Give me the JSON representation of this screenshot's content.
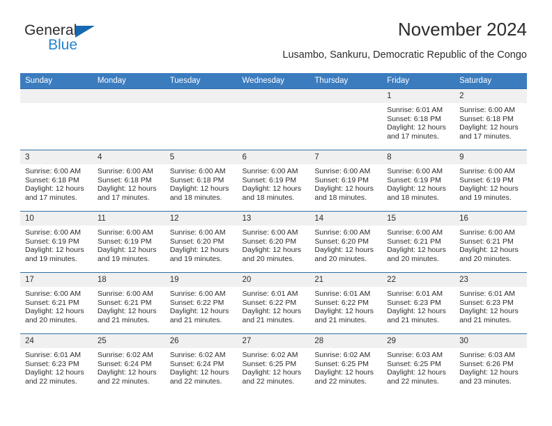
{
  "brand": {
    "name_part1": "General",
    "name_part2": "Blue",
    "triangle_color": "#1769b0",
    "blue_color": "#2484cd"
  },
  "header": {
    "title": "November 2024",
    "subtitle": "Lusambo, Sankuru, Democratic Republic of the Congo"
  },
  "theme": {
    "header_bar": "#3b7cbf",
    "cell_top_border": "#2e6da4",
    "daynum_bg": "#f0f0f0",
    "text": "#2b2b2b"
  },
  "calendar": {
    "weekdays": [
      "Sunday",
      "Monday",
      "Tuesday",
      "Wednesday",
      "Thursday",
      "Friday",
      "Saturday"
    ],
    "weeks": [
      [
        {
          "day": "",
          "lines": []
        },
        {
          "day": "",
          "lines": []
        },
        {
          "day": "",
          "lines": []
        },
        {
          "day": "",
          "lines": []
        },
        {
          "day": "",
          "lines": []
        },
        {
          "day": "1",
          "lines": [
            "Sunrise: 6:01 AM",
            "Sunset: 6:18 PM",
            "Daylight: 12 hours",
            "and 17 minutes."
          ]
        },
        {
          "day": "2",
          "lines": [
            "Sunrise: 6:00 AM",
            "Sunset: 6:18 PM",
            "Daylight: 12 hours",
            "and 17 minutes."
          ]
        }
      ],
      [
        {
          "day": "3",
          "lines": [
            "Sunrise: 6:00 AM",
            "Sunset: 6:18 PM",
            "Daylight: 12 hours",
            "and 17 minutes."
          ]
        },
        {
          "day": "4",
          "lines": [
            "Sunrise: 6:00 AM",
            "Sunset: 6:18 PM",
            "Daylight: 12 hours",
            "and 17 minutes."
          ]
        },
        {
          "day": "5",
          "lines": [
            "Sunrise: 6:00 AM",
            "Sunset: 6:18 PM",
            "Daylight: 12 hours",
            "and 18 minutes."
          ]
        },
        {
          "day": "6",
          "lines": [
            "Sunrise: 6:00 AM",
            "Sunset: 6:19 PM",
            "Daylight: 12 hours",
            "and 18 minutes."
          ]
        },
        {
          "day": "7",
          "lines": [
            "Sunrise: 6:00 AM",
            "Sunset: 6:19 PM",
            "Daylight: 12 hours",
            "and 18 minutes."
          ]
        },
        {
          "day": "8",
          "lines": [
            "Sunrise: 6:00 AM",
            "Sunset: 6:19 PM",
            "Daylight: 12 hours",
            "and 18 minutes."
          ]
        },
        {
          "day": "9",
          "lines": [
            "Sunrise: 6:00 AM",
            "Sunset: 6:19 PM",
            "Daylight: 12 hours",
            "and 19 minutes."
          ]
        }
      ],
      [
        {
          "day": "10",
          "lines": [
            "Sunrise: 6:00 AM",
            "Sunset: 6:19 PM",
            "Daylight: 12 hours",
            "and 19 minutes."
          ]
        },
        {
          "day": "11",
          "lines": [
            "Sunrise: 6:00 AM",
            "Sunset: 6:19 PM",
            "Daylight: 12 hours",
            "and 19 minutes."
          ]
        },
        {
          "day": "12",
          "lines": [
            "Sunrise: 6:00 AM",
            "Sunset: 6:20 PM",
            "Daylight: 12 hours",
            "and 19 minutes."
          ]
        },
        {
          "day": "13",
          "lines": [
            "Sunrise: 6:00 AM",
            "Sunset: 6:20 PM",
            "Daylight: 12 hours",
            "and 20 minutes."
          ]
        },
        {
          "day": "14",
          "lines": [
            "Sunrise: 6:00 AM",
            "Sunset: 6:20 PM",
            "Daylight: 12 hours",
            "and 20 minutes."
          ]
        },
        {
          "day": "15",
          "lines": [
            "Sunrise: 6:00 AM",
            "Sunset: 6:21 PM",
            "Daylight: 12 hours",
            "and 20 minutes."
          ]
        },
        {
          "day": "16",
          "lines": [
            "Sunrise: 6:00 AM",
            "Sunset: 6:21 PM",
            "Daylight: 12 hours",
            "and 20 minutes."
          ]
        }
      ],
      [
        {
          "day": "17",
          "lines": [
            "Sunrise: 6:00 AM",
            "Sunset: 6:21 PM",
            "Daylight: 12 hours",
            "and 20 minutes."
          ]
        },
        {
          "day": "18",
          "lines": [
            "Sunrise: 6:00 AM",
            "Sunset: 6:21 PM",
            "Daylight: 12 hours",
            "and 21 minutes."
          ]
        },
        {
          "day": "19",
          "lines": [
            "Sunrise: 6:00 AM",
            "Sunset: 6:22 PM",
            "Daylight: 12 hours",
            "and 21 minutes."
          ]
        },
        {
          "day": "20",
          "lines": [
            "Sunrise: 6:01 AM",
            "Sunset: 6:22 PM",
            "Daylight: 12 hours",
            "and 21 minutes."
          ]
        },
        {
          "day": "21",
          "lines": [
            "Sunrise: 6:01 AM",
            "Sunset: 6:22 PM",
            "Daylight: 12 hours",
            "and 21 minutes."
          ]
        },
        {
          "day": "22",
          "lines": [
            "Sunrise: 6:01 AM",
            "Sunset: 6:23 PM",
            "Daylight: 12 hours",
            "and 21 minutes."
          ]
        },
        {
          "day": "23",
          "lines": [
            "Sunrise: 6:01 AM",
            "Sunset: 6:23 PM",
            "Daylight: 12 hours",
            "and 21 minutes."
          ]
        }
      ],
      [
        {
          "day": "24",
          "lines": [
            "Sunrise: 6:01 AM",
            "Sunset: 6:23 PM",
            "Daylight: 12 hours",
            "and 22 minutes."
          ]
        },
        {
          "day": "25",
          "lines": [
            "Sunrise: 6:02 AM",
            "Sunset: 6:24 PM",
            "Daylight: 12 hours",
            "and 22 minutes."
          ]
        },
        {
          "day": "26",
          "lines": [
            "Sunrise: 6:02 AM",
            "Sunset: 6:24 PM",
            "Daylight: 12 hours",
            "and 22 minutes."
          ]
        },
        {
          "day": "27",
          "lines": [
            "Sunrise: 6:02 AM",
            "Sunset: 6:25 PM",
            "Daylight: 12 hours",
            "and 22 minutes."
          ]
        },
        {
          "day": "28",
          "lines": [
            "Sunrise: 6:02 AM",
            "Sunset: 6:25 PM",
            "Daylight: 12 hours",
            "and 22 minutes."
          ]
        },
        {
          "day": "29",
          "lines": [
            "Sunrise: 6:03 AM",
            "Sunset: 6:25 PM",
            "Daylight: 12 hours",
            "and 22 minutes."
          ]
        },
        {
          "day": "30",
          "lines": [
            "Sunrise: 6:03 AM",
            "Sunset: 6:26 PM",
            "Daylight: 12 hours",
            "and 23 minutes."
          ]
        }
      ]
    ]
  }
}
